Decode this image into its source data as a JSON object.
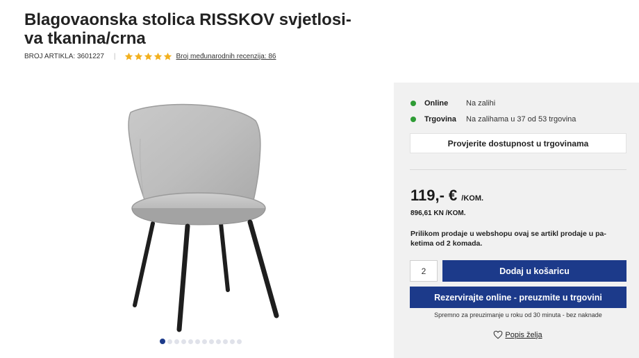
{
  "product": {
    "title_line1": "Blagovaonska stolica RISSKOV svjetlosi-",
    "title_line2": "va tkanina/crna",
    "article_label": "BROJ ARTIKLA: 3601227",
    "separator": "|",
    "rating_stars": 5,
    "reviews_link": "Broj međunarodnih recenzija: 86"
  },
  "gallery": {
    "image_icon": "chair-image",
    "dot_count": 12,
    "active_dot": 0
  },
  "availability": {
    "online": {
      "label": "Online",
      "status": "Na zalihi"
    },
    "store": {
      "label": "Trgovina",
      "status": "Na zalihama u 37 od 53 trgovina"
    },
    "check_button": "Provjerite dostupnost u trgovinama"
  },
  "pricing": {
    "price": "119,- €",
    "unit": "/KOM.",
    "price_kn": "896,61 KN /KOM.",
    "note": "Prilikom prodaje u webshopu ovaj se artikl prodaje u pa-ketima od 2 komada."
  },
  "purchase": {
    "quantity": "2",
    "add_to_cart": "Dodaj u košaricu",
    "reserve": "Rezervirajte online - preuzmite u trgovini",
    "pickup_note": "Spremno za preuzimanje u roku od 30 minuta - bez naknade",
    "wishlist": "Popis želja"
  },
  "colors": {
    "accent_blue": "#1c3a8a",
    "stock_green": "#2e9c35",
    "star_gold": "#f2b01e",
    "panel_bg": "#f1f1f1"
  }
}
